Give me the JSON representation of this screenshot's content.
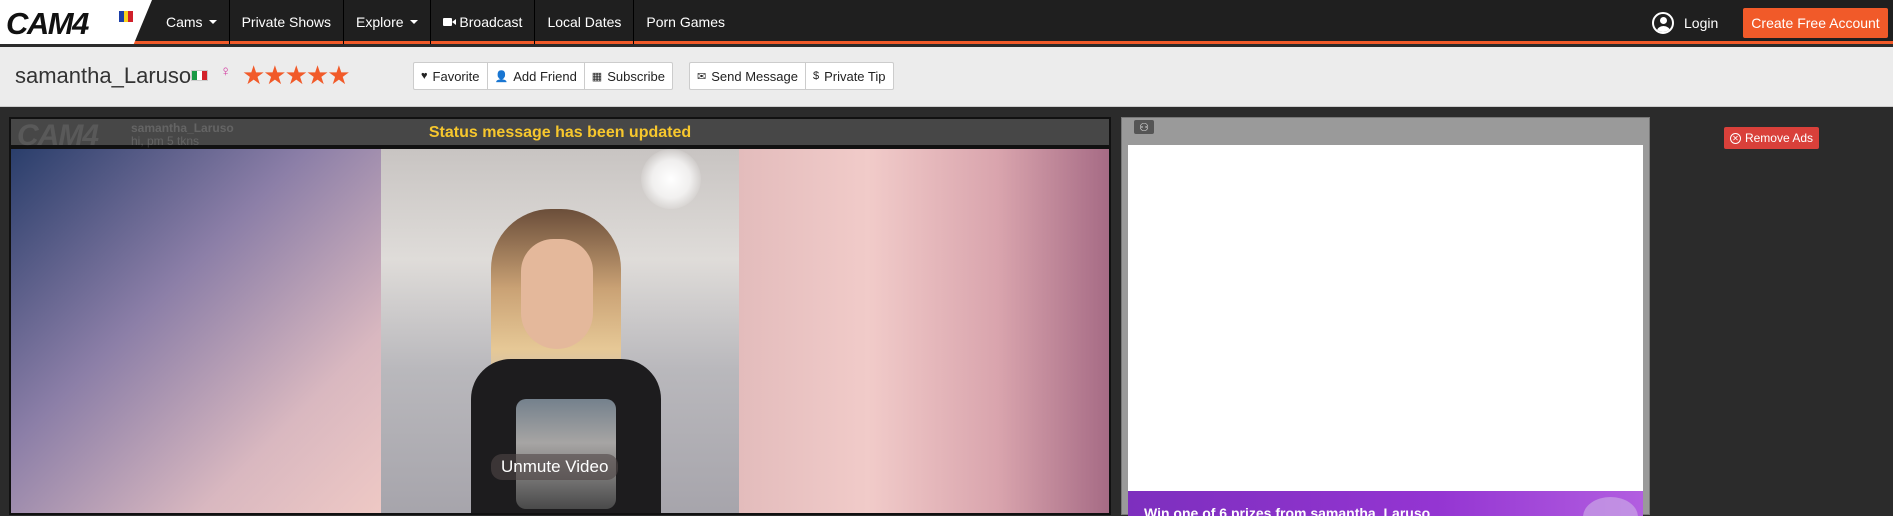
{
  "nav": {
    "logo_text": "CAM4",
    "items": [
      {
        "label": "Cams",
        "caret": true
      },
      {
        "label": "Private Shows"
      },
      {
        "label": "Explore",
        "caret": true
      },
      {
        "label": "Broadcast",
        "icon": "camera-icon"
      },
      {
        "label": "Local Dates"
      },
      {
        "label": "Porn Games"
      }
    ],
    "login_label": "Login",
    "create_label": "Create Free Account",
    "accent_color": "#f15a29"
  },
  "profile": {
    "username": "samantha_Laruso",
    "gender_symbol": "♀",
    "stars": "★★★★★",
    "buttons_group1": [
      {
        "label": "Favorite",
        "icon": "♥"
      },
      {
        "label": "Add Friend",
        "icon": "👤"
      },
      {
        "label": "Subscribe",
        "icon": "▦"
      }
    ],
    "buttons_group2": [
      {
        "label": "Send Message",
        "icon": "✉"
      },
      {
        "label": "Private Tip",
        "icon": "$"
      }
    ]
  },
  "video": {
    "watermark": "CAM4",
    "watermark_user": "samantha_Laruso",
    "watermark_sub": "hi, pm 5 tkns",
    "status_message": "Status message has been updated",
    "unmute_label": "Unmute Video"
  },
  "chat": {
    "promo_text": "Win one of 6 prizes from samantha_Laruso"
  },
  "ads": {
    "remove_label": "Remove Ads"
  }
}
